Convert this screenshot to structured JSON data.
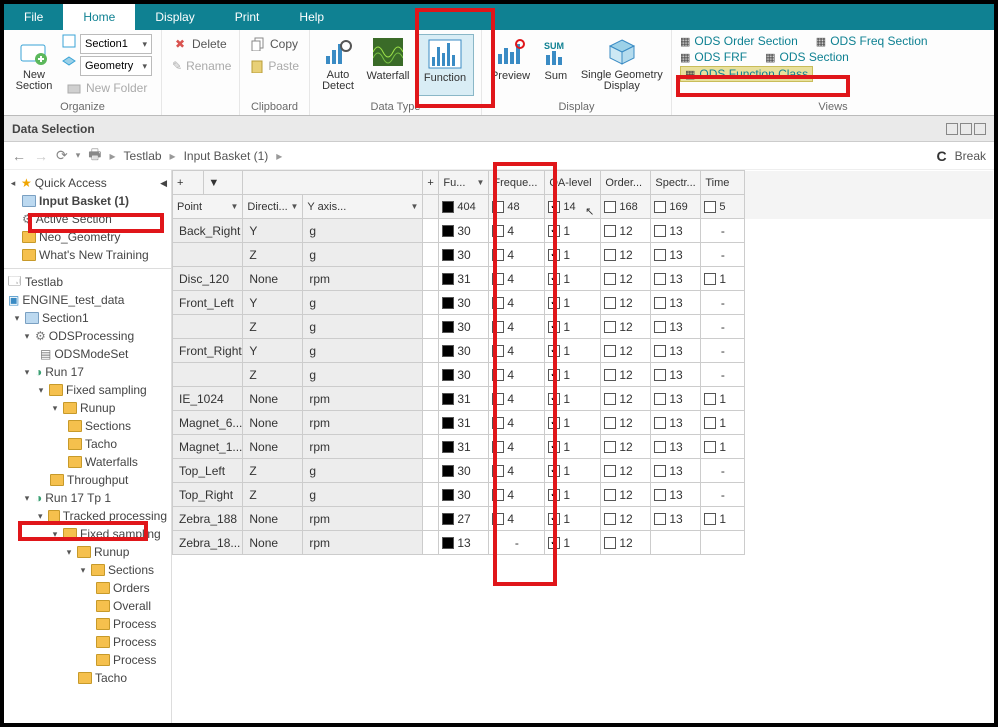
{
  "menu": {
    "file": "File",
    "home": "Home",
    "display": "Display",
    "print": "Print",
    "help": "Help"
  },
  "ribbon": {
    "newSection": "New\nSection",
    "section1": "Section1",
    "geometry": "Geometry",
    "newFolder": "New Folder",
    "delete": "Delete",
    "rename": "Rename",
    "organize": "Organize",
    "copy": "Copy",
    "paste": "Paste",
    "clipboard": "Clipboard",
    "autoDetect": "Auto\nDetect",
    "waterfall": "Waterfall",
    "function": "Function",
    "dataType": "Data Type",
    "preview": "Preview",
    "sum": "Sum",
    "singleGeom": "Single Geometry\nDisplay",
    "display": "Display",
    "views": "Views",
    "v1": "ODS Order Section",
    "v2": "ODS FRF",
    "v3": "ODS Function Class",
    "v4": "ODS Freq Section",
    "v5": "ODS Section"
  },
  "selbar": "Data Selection",
  "crumb": {
    "testlab": "Testlab",
    "ib": "Input Basket (1)",
    "break": "Break"
  },
  "tree": {
    "quick": "Quick Access",
    "ib": "Input Basket (1)",
    "as": "Active Section",
    "neo": "Neo_Geometry",
    "wn": "What's New Training",
    "testlab": "Testlab",
    "etd": "ENGINE_test_data",
    "s1": "Section1",
    "ods": "ODSProcessing",
    "modeset": "ODSModeSet",
    "r17": "Run 17",
    "fixed": "Fixed sampling",
    "runup": "Runup",
    "sections": "Sections",
    "tacho": "Tacho",
    "wf": "Waterfalls",
    "thr": "Throughput",
    "r17t": "Run 17 Tp 1",
    "trk": "Tracked processing",
    "orders": "Orders",
    "overall": "Overall",
    "process": "Process"
  },
  "cols": {
    "plus": "+",
    "filter": "▼",
    "plus2": "+",
    "func": "Fu...",
    "freq": "Freque...",
    "oa": "OA-level",
    "order": "Order...",
    "spec": "Spectr...",
    "time": "Time",
    "point": "Point",
    "dir": "Directi...",
    "yaxis": "Y axis..."
  },
  "hdr": {
    "func": "404",
    "freq": "48",
    "oa": "14",
    "order": "168",
    "spec": "169",
    "time": "5"
  },
  "rows": [
    {
      "p": "Back_Right",
      "d": "Y",
      "y": "g",
      "f": "30",
      "q": "4",
      "oa": "1",
      "o": "12",
      "s": "13",
      "t": "-"
    },
    {
      "p": "",
      "d": "Z",
      "y": "g",
      "f": "30",
      "q": "4",
      "oa": "1",
      "o": "12",
      "s": "13",
      "t": "-"
    },
    {
      "p": "Disc_120",
      "d": "None",
      "y": "rpm",
      "f": "31",
      "q": "4",
      "oa": "1",
      "o": "12",
      "s": "13",
      "t": "1"
    },
    {
      "p": "Front_Left",
      "d": "Y",
      "y": "g",
      "f": "30",
      "q": "4",
      "oa": "1",
      "o": "12",
      "s": "13",
      "t": "-"
    },
    {
      "p": "",
      "d": "Z",
      "y": "g",
      "f": "30",
      "q": "4",
      "oa": "1",
      "o": "12",
      "s": "13",
      "t": "-"
    },
    {
      "p": "Front_Right",
      "d": "Y",
      "y": "g",
      "f": "30",
      "q": "4",
      "oa": "1",
      "o": "12",
      "s": "13",
      "t": "-"
    },
    {
      "p": "",
      "d": "Z",
      "y": "g",
      "f": "30",
      "q": "4",
      "oa": "1",
      "o": "12",
      "s": "13",
      "t": "-"
    },
    {
      "p": "IE_1024",
      "d": "None",
      "y": "rpm",
      "f": "31",
      "q": "4",
      "oa": "1",
      "o": "12",
      "s": "13",
      "t": "1"
    },
    {
      "p": "Magnet_6...",
      "d": "None",
      "y": "rpm",
      "f": "31",
      "q": "4",
      "oa": "1",
      "o": "12",
      "s": "13",
      "t": "1"
    },
    {
      "p": "Magnet_1...",
      "d": "None",
      "y": "rpm",
      "f": "31",
      "q": "4",
      "oa": "1",
      "o": "12",
      "s": "13",
      "t": "1"
    },
    {
      "p": "Top_Left",
      "d": "Z",
      "y": "g",
      "f": "30",
      "q": "4",
      "oa": "1",
      "o": "12",
      "s": "13",
      "t": "-"
    },
    {
      "p": "Top_Right",
      "d": "Z",
      "y": "g",
      "f": "30",
      "q": "4",
      "oa": "1",
      "o": "12",
      "s": "13",
      "t": "-"
    },
    {
      "p": "Zebra_188",
      "d": "None",
      "y": "rpm",
      "f": "27",
      "q": "4",
      "oa": "1",
      "o": "12",
      "s": "13",
      "t": "1"
    },
    {
      "p": "Zebra_18...",
      "d": "None",
      "y": "rpm",
      "f": "13",
      "q": "-",
      "oa": "1",
      "o": "12",
      "s": "",
      "t": ""
    }
  ]
}
